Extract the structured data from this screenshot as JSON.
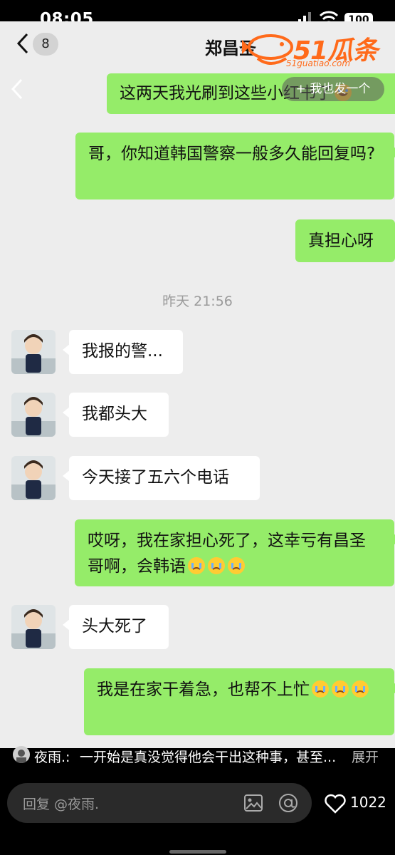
{
  "status_bar": {
    "time": "08:05",
    "battery": "100"
  },
  "header": {
    "unread_count": "8",
    "contact_name": "郑昌圣"
  },
  "watermark": {
    "brand": "51瓜条",
    "url": "51guatiao.com"
  },
  "overlay": {
    "post_button": "+ 我也发一个"
  },
  "messages": [
    {
      "side": "me",
      "text": "这两天我光刷到这些小红书了",
      "emoji": [
        "laugh-cry-emoji"
      ]
    },
    {
      "side": "me",
      "text": "哥，你知道韩国警察一般多久能回复吗?",
      "emoji": []
    },
    {
      "side": "me",
      "text": "真担心呀",
      "emoji": []
    },
    {
      "side": "them",
      "text": "我报的警...",
      "emoji": []
    },
    {
      "side": "them",
      "text": "我都头大",
      "emoji": []
    },
    {
      "side": "them",
      "text": "今天接了五六个电话",
      "emoji": []
    },
    {
      "side": "me",
      "text": "哎呀，我在家担心死了，这幸亏有昌圣哥啊，会韩语",
      "emoji": [
        "cry-emoji",
        "cry-emoji",
        "cry-emoji"
      ]
    },
    {
      "side": "them",
      "text": "头大死了",
      "emoji": []
    },
    {
      "side": "me",
      "text": "我是在家干着急，也帮不上忙",
      "emoji": [
        "cry-emoji",
        "cry-emoji",
        "cry-emoji"
      ]
    }
  ],
  "timestamp": "昨天 21:56",
  "comment": {
    "author": "夜雨.:",
    "text": "一开始是真没觉得他会干出这种事，甚至...",
    "expand_label": "展开"
  },
  "reply": {
    "placeholder": "回复 @夜雨."
  },
  "likes": {
    "count": "1022"
  },
  "colors": {
    "me_bubble": "#95ec69",
    "them_bubble": "#ffffff",
    "chat_bg": "#ededed",
    "brand": "#ff6a1a"
  }
}
